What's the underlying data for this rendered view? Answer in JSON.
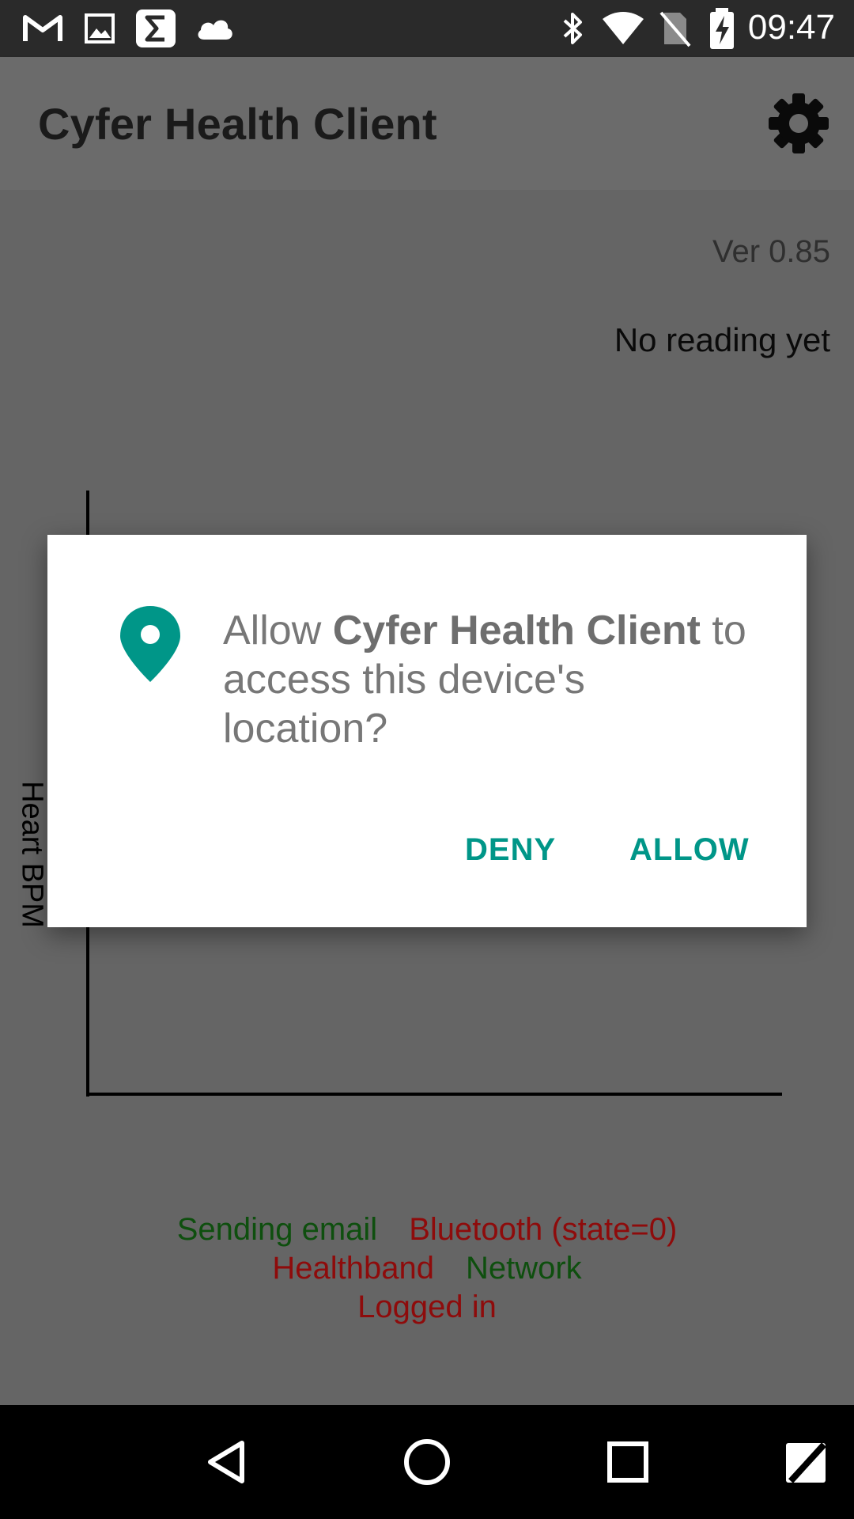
{
  "status_bar": {
    "time": "09:47",
    "left_icons": [
      "gmail-icon",
      "gallery-icon",
      "sigma-app-icon",
      "cloud-icon"
    ],
    "right_icons": [
      "bluetooth-icon",
      "wifi-icon",
      "no-sim-icon",
      "battery-charging-icon"
    ]
  },
  "app_bar": {
    "title": "Cyfer Health Client",
    "settings_icon": "gear-icon"
  },
  "main": {
    "version": "Ver 0.85",
    "reading": "No reading yet",
    "graph_y_label": "Heart BPM"
  },
  "status_items": [
    {
      "text": "Sending email",
      "color": "#0e4f0e"
    },
    {
      "text": "Bluetooth (state=0)",
      "color": "#8e0b0b"
    },
    {
      "text": "Healthband",
      "color": "#8e0b0b"
    },
    {
      "text": "Network",
      "color": "#0e4f0e"
    },
    {
      "text": "Logged in",
      "color": "#8e0b0b"
    }
  ],
  "dialog": {
    "icon": "location-pin-icon",
    "message_prefix": "Allow ",
    "app_name": "Cyfer Health Client",
    "message_suffix": " to access this device's location?",
    "deny_label": "DENY",
    "allow_label": "ALLOW",
    "accent_color": "#009688"
  },
  "nav_bar": {
    "icons": [
      "back-icon",
      "home-icon",
      "recents-icon",
      "edit-icon"
    ]
  }
}
